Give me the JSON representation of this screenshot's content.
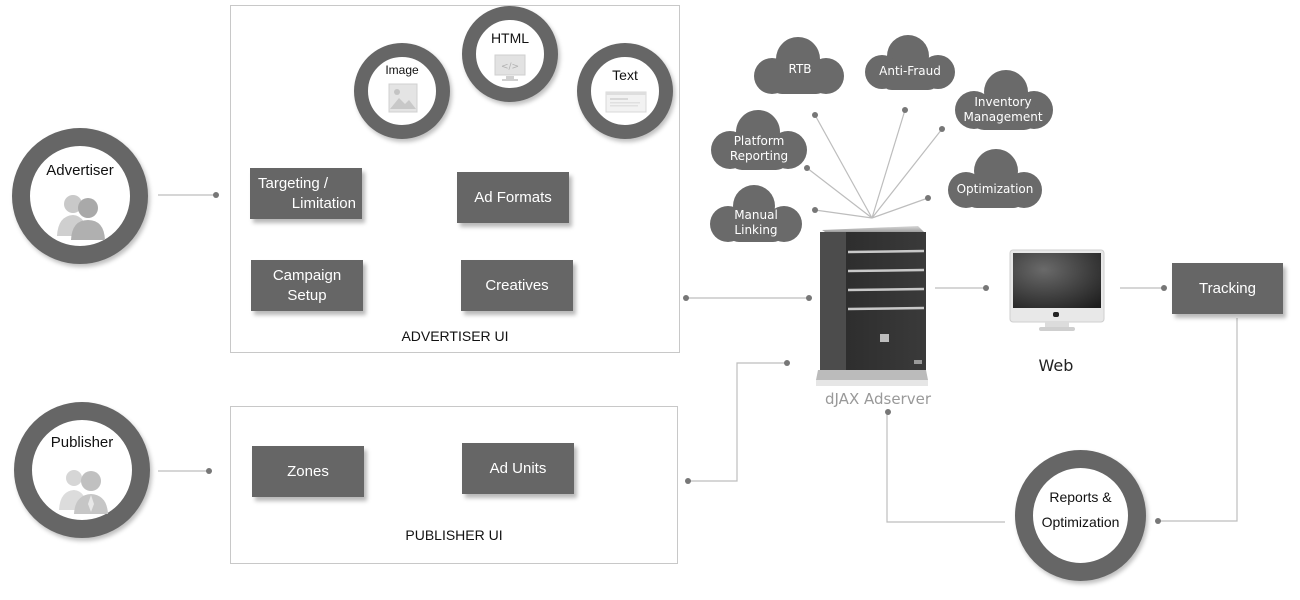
{
  "actors": {
    "advertiser": {
      "label": "Advertiser",
      "icon": "users-icon"
    },
    "publisher": {
      "label": "Publisher",
      "icon": "users-icon"
    }
  },
  "advertiser_ui": {
    "title": "ADVERTISER UI",
    "boxes": {
      "targeting": [
        "Targeting /",
        "Limitation"
      ],
      "campaign": [
        "Campaign",
        "Setup"
      ],
      "ad_formats": "Ad Formats",
      "creatives": "Creatives"
    },
    "formats": [
      {
        "label": "Image",
        "icon": "image-icon"
      },
      {
        "label": "HTML",
        "icon": "code-monitor-icon"
      },
      {
        "label": "Text",
        "icon": "text-document-icon"
      }
    ]
  },
  "publisher_ui": {
    "title": "PUBLISHER UI",
    "boxes": {
      "zones": "Zones",
      "ad_units": "Ad Units"
    }
  },
  "clouds": {
    "rtb": [
      "RTB"
    ],
    "anti_fraud": [
      "Anti-Fraud"
    ],
    "inventory": [
      "Inventory",
      "Management"
    ],
    "platform_reporting": [
      "Platform",
      "Reporting"
    ],
    "optimization": [
      "Optimization"
    ],
    "manual_linking": [
      "Manual",
      "Linking"
    ]
  },
  "server": {
    "label": "dJAX Adserver",
    "icon": "server-tower-icon"
  },
  "web": {
    "label": "Web",
    "icon": "desktop-monitor-icon"
  },
  "tracking": {
    "label": "Tracking"
  },
  "reports": {
    "label": [
      "Reports &",
      "Optimization"
    ]
  },
  "colors": {
    "box": "#666666",
    "ring": "#666666",
    "wire": "#bbbbbb",
    "dot": "#777777",
    "server_label": "#999999"
  }
}
